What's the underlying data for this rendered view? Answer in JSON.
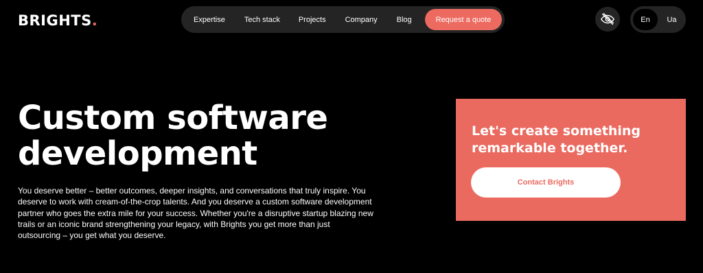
{
  "brand": {
    "logo_text": "BRIGHTS",
    "logo_dot": ".",
    "accent_color": "#ec6a60"
  },
  "nav": {
    "items": [
      {
        "label": "Expertise"
      },
      {
        "label": "Tech stack"
      },
      {
        "label": "Projects"
      },
      {
        "label": "Company"
      },
      {
        "label": "Blog"
      }
    ],
    "quote_label": "Request a quote"
  },
  "accessibility": {
    "icon": "eye-slash-icon"
  },
  "language": {
    "options": [
      "En",
      "Ua"
    ],
    "selected": "En"
  },
  "hero": {
    "title_line1": "Custom software",
    "title_line2": "development",
    "description": "You deserve better – better outcomes, deeper insights, and conversations that truly inspire. You deserve to work with cream-of-the-crop talents. And you deserve a custom software development partner who goes the extra mile for your success. Whether you're a disruptive startup blazing new trails or an iconic brand strengthening your legacy, with Brights you get more than just outsourcing – you get what you deserve."
  },
  "cta": {
    "heading_line1": "Let's create something",
    "heading_line2": "remarkable together.",
    "button_label": "Contact Brights"
  }
}
